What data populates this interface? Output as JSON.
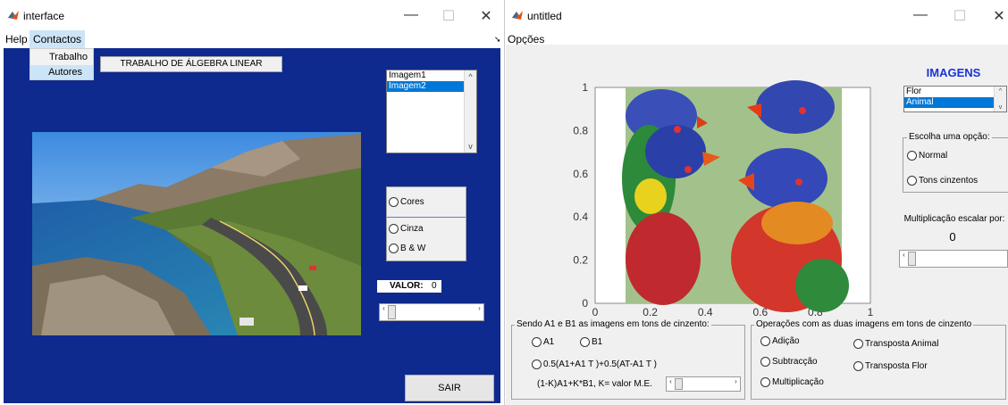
{
  "win1": {
    "title": "interface",
    "menu": {
      "help": "Help",
      "contactos": "Contactos"
    },
    "dropdown": [
      "Trabalho",
      "Autores"
    ],
    "header_label": "TRABALHO DE ÁLGEBRA LINEAR",
    "image_list": [
      "Imagem1",
      "Imagem2"
    ],
    "radio_group": [
      "Cores",
      "Cinza",
      "B & W"
    ],
    "valor_label": "VALOR:",
    "valor_value": "0",
    "exit_button": "SAIR"
  },
  "win2": {
    "title": "untitled",
    "menu": {
      "opcoes": "Opções"
    },
    "heading": "IMAGENS",
    "image_list": [
      "Flor",
      "Animal"
    ],
    "choose_group": {
      "title": "Escolha uma opção:",
      "options": [
        "Normal",
        "Tons cinzentos"
      ]
    },
    "scalar_label": "Multiplicação escalar por:",
    "scalar_value": "0",
    "left_group": {
      "title": "Sendo A1 e B1 as imagens em tons de cinzento:",
      "opt_a1": "A1",
      "opt_b1": "B1",
      "opt_formula": "0.5(A1+A1 T )+0.5(AT-A1 T )",
      "combo_label": "(1-K)A1+K*B1, K= valor M.E."
    },
    "right_group": {
      "title": "Operações com as duas imagens em tons de cinzento",
      "opt_add": "Adição",
      "opt_sub": "Subtracção",
      "opt_mul": "Multiplicação",
      "opt_t_animal": "Transposta Animal",
      "opt_t_flor": "Transposta Flor"
    }
  },
  "chart_data": {
    "type": "image-axes",
    "y_ticks": [
      "0",
      "0.2",
      "0.4",
      "0.6",
      "0.8",
      "1"
    ],
    "x_ticks": [
      "0",
      "0.2",
      "0.4",
      "0.6",
      "0.8",
      "1"
    ],
    "xlim": [
      0,
      1
    ],
    "ylim": [
      0,
      1
    ]
  },
  "colors": {
    "figure_blue": "#0e2a8e",
    "heading_blue": "#1a33d6",
    "selection": "#0078d7"
  }
}
